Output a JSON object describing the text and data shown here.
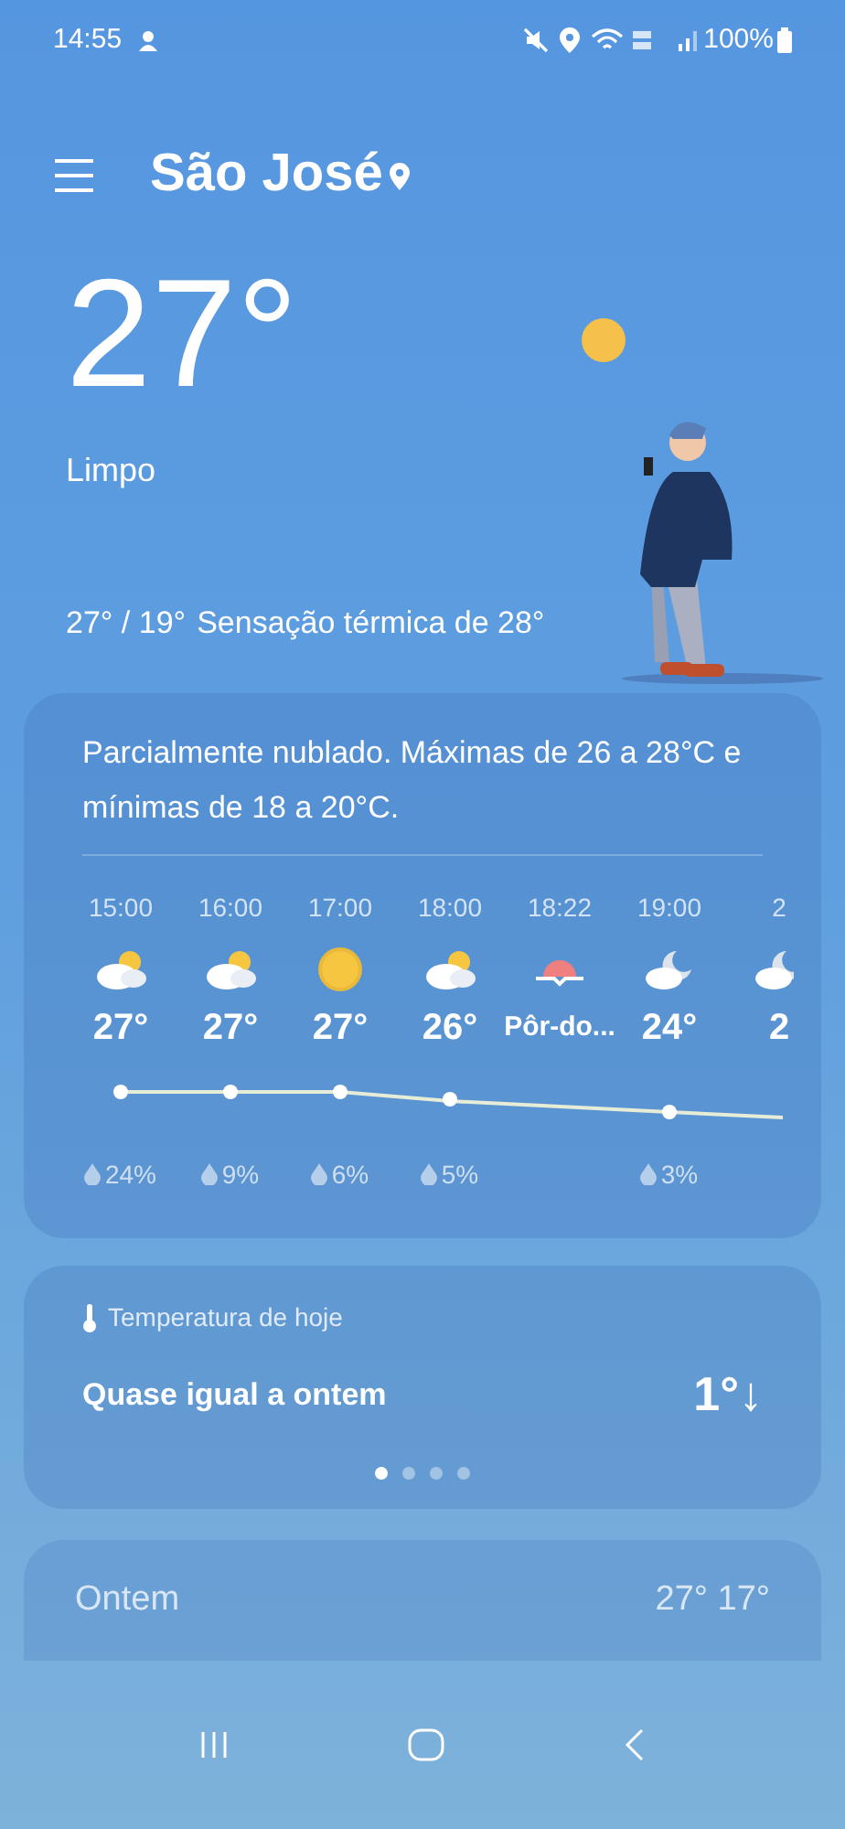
{
  "status_bar": {
    "time": "14:55",
    "battery": "100%"
  },
  "header": {
    "city": "São José"
  },
  "current": {
    "temperature": "27°",
    "condition": "Limpo",
    "high_low": "27° / 19°",
    "feels_like": "Sensação térmica de 28°"
  },
  "forecast_card": {
    "summary": "Parcialmente nublado. Máximas de 26 a 28°C e mínimas de 18 a 20°C.",
    "hours": [
      {
        "time": "15:00",
        "kind": "partly_cloudy",
        "temp": "27°",
        "precip": "24%"
      },
      {
        "time": "16:00",
        "kind": "partly_cloudy",
        "temp": "27°",
        "precip": "9%"
      },
      {
        "time": "17:00",
        "kind": "sunny",
        "temp": "27°",
        "precip": "6%"
      },
      {
        "time": "18:00",
        "kind": "partly_cloudy",
        "temp": "26°",
        "precip": "5%"
      },
      {
        "time": "18:22",
        "kind": "sunset",
        "temp": "Pôr-do..."
      },
      {
        "time": "19:00",
        "kind": "night_cloudy",
        "temp": "24°",
        "precip": "3%"
      },
      {
        "time": "2",
        "kind": "night_cloudy",
        "temp": "2"
      }
    ]
  },
  "today_card": {
    "label": "Temperatura de hoje",
    "message": "Quase igual a ontem",
    "difference": "1°↓",
    "pages": [
      {
        "selected": true
      },
      {
        "selected": false
      },
      {
        "selected": false
      },
      {
        "selected": false
      }
    ]
  },
  "yesterday_card": {
    "label": "Ontem",
    "temps": "27° 17°"
  }
}
